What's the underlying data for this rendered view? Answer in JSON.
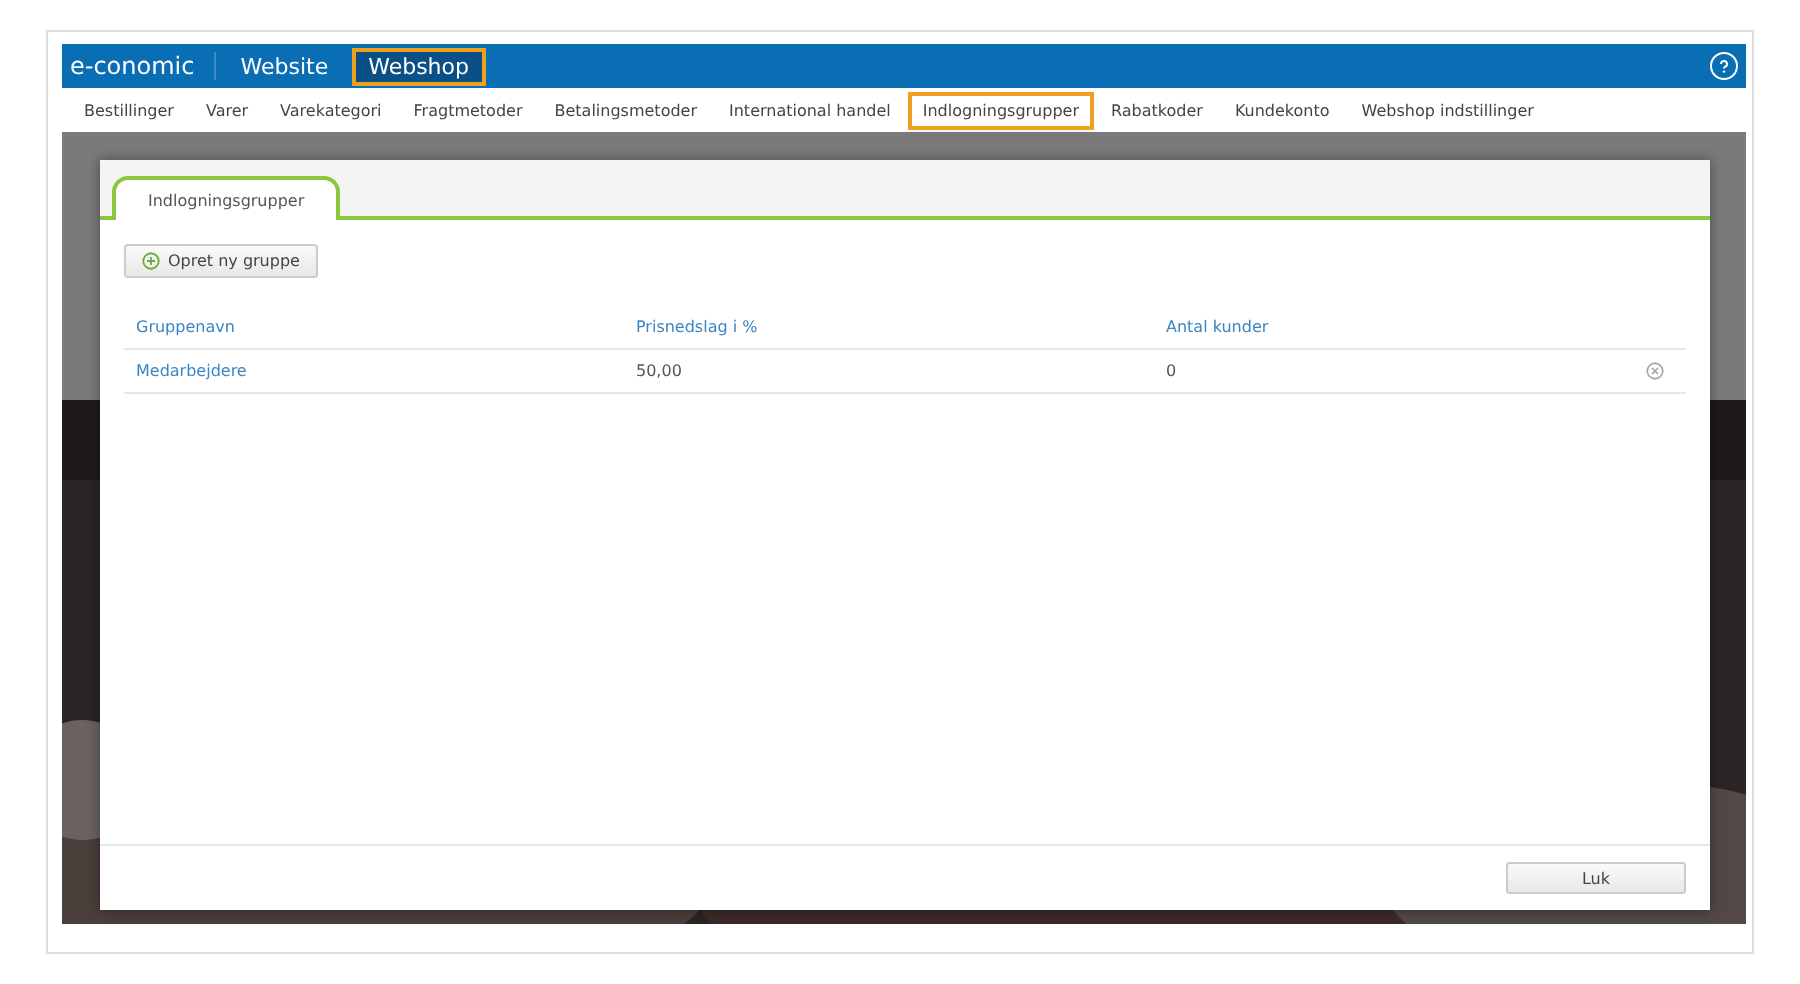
{
  "top_bar": {
    "logo": "e-conomic",
    "items": [
      {
        "label": "Website",
        "selected": false
      },
      {
        "label": "Webshop",
        "selected": true
      }
    ]
  },
  "nav": [
    {
      "label": "Bestillinger",
      "selected": false
    },
    {
      "label": "Varer",
      "selected": false
    },
    {
      "label": "Varekategori",
      "selected": false
    },
    {
      "label": "Fragtmetoder",
      "selected": false
    },
    {
      "label": "Betalingsmetoder",
      "selected": false
    },
    {
      "label": "International handel",
      "selected": false
    },
    {
      "label": "Indlogningsgrupper",
      "selected": true
    },
    {
      "label": "Rabatkoder",
      "selected": false
    },
    {
      "label": "Kundekonto",
      "selected": false
    },
    {
      "label": "Webshop indstillinger",
      "selected": false
    }
  ],
  "dialog": {
    "tab": "Indlogningsgrupper",
    "create_button": "Opret ny gruppe",
    "table": {
      "columns": [
        "Gruppenavn",
        "Prisnedslag i %",
        "Antal kunder"
      ],
      "rows": [
        {
          "name": "Medarbejdere",
          "discount": "50,00",
          "customers": "0"
        }
      ]
    },
    "close_button": "Luk"
  }
}
